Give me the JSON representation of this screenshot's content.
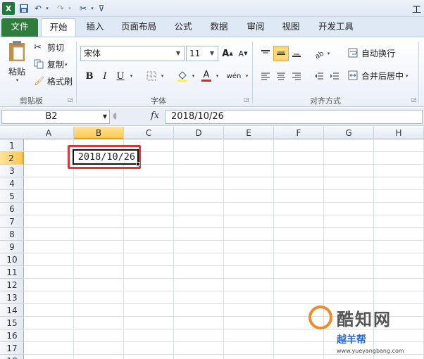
{
  "window": {
    "title_fragment": "工"
  },
  "tabs": [
    "文件",
    "开始",
    "插入",
    "页面布局",
    "公式",
    "数据",
    "审阅",
    "视图",
    "开发工具"
  ],
  "clipboard": {
    "paste": "粘贴",
    "cut": "剪切",
    "copy": "复制",
    "format_painter": "格式刷",
    "label": "剪贴板"
  },
  "font": {
    "name": "宋体",
    "size": "11",
    "bold": "B",
    "italic": "I",
    "underline": "U",
    "label": "字体"
  },
  "alignment": {
    "wrap_text": "自动换行",
    "merge_center": "合并后居中",
    "label": "对齐方式"
  },
  "formula_bar": {
    "name_box": "B2",
    "fx": "fx",
    "value": "2018/10/26"
  },
  "sheet": {
    "columns": [
      "A",
      "B",
      "C",
      "D",
      "E",
      "F",
      "G",
      "H"
    ],
    "rows": [
      "1",
      "2",
      "3",
      "4",
      "5",
      "6",
      "7",
      "8",
      "9",
      "10",
      "11",
      "12",
      "13",
      "14",
      "15",
      "16",
      "17",
      "18"
    ],
    "selected_column": "B",
    "selected_row": "2",
    "active_cell_value": "2018/10/26"
  },
  "watermark": {
    "brand": "酷知网",
    "site_cn": "越羊帮",
    "site_url": "www.yueyangbang.com"
  },
  "colors": {
    "file_tab": "#2f7d3a",
    "selection_highlight": "#d6383d",
    "header_selected": "#f9c84f"
  }
}
